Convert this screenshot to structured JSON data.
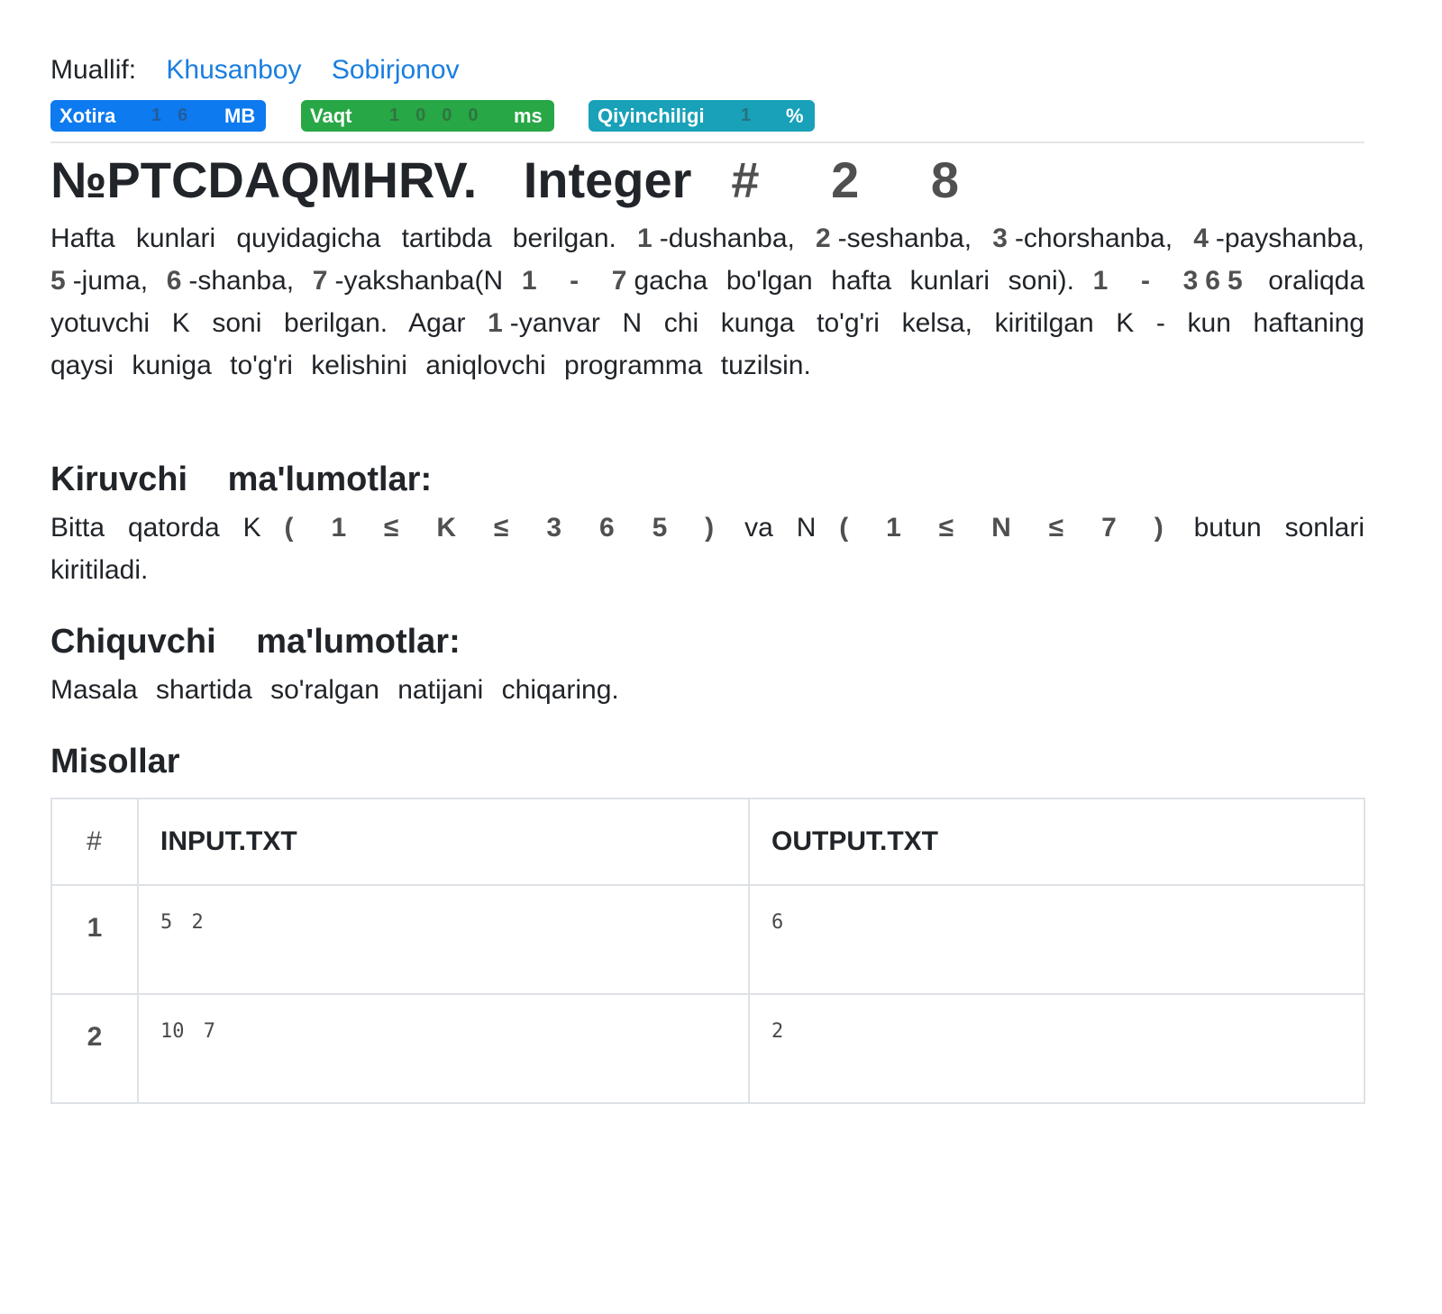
{
  "author": {
    "label": "Muallif:",
    "first_name": "Khusanboy",
    "last_name": "Sobirjonov"
  },
  "badges": {
    "memory": {
      "label": "Xotira",
      "value": "16",
      "unit": "MB"
    },
    "time": {
      "label": "Vaqt",
      "value": "1000",
      "unit": "ms"
    },
    "difficulty": {
      "label": "Qiyinchiligi",
      "value": "1",
      "unit": "%"
    }
  },
  "problem": {
    "code": "№PTCDAQMHRV.",
    "name": "Integer",
    "hash": "# 2 8"
  },
  "statement": {
    "s1": "Hafta kunlari quyidagicha tartibda berilgan.",
    "n1": "1",
    "d1": "-dushanba,",
    "n2": "2",
    "d2": "-seshanba,",
    "n3": "3",
    "d3": "-chorshanba,",
    "n4": "4",
    "d4": "-payshanba,",
    "n5": "5",
    "d5": "-juma,",
    "n6": "6",
    "d6": "-shanba,",
    "n7": "7",
    "d7": "-yakshanba(N",
    "range1": "1 - 7",
    "s2": "gacha bo'lgan hafta kunlari soni).",
    "range2": "1 - 365",
    "s3": "oraliqda yotuvchi K soni berilgan. Agar",
    "n8": "1",
    "s4": "-yanvar N chi kunga to'g'ri kelsa, kiritilgan K - kun haftaning qaysi kuniga to'g'ri kelishini aniqlovchi programma tuzilsin."
  },
  "input_section": {
    "heading": "Kiruvchi ma'lumotlar:",
    "t1": "Bitta qatorda K",
    "t2": "( 1 ≤ K ≤ 3 6 5 )",
    "t3": "va N",
    "t4": "( 1 ≤ N ≤ 7 )",
    "t5": "butun sonlari kiritiladi."
  },
  "output_section": {
    "heading": "Chiquvchi ma'lumotlar:",
    "text": "Masala shartida so'ralgan natijani chiqaring."
  },
  "examples": {
    "heading": "Misollar",
    "columns": [
      "#",
      "INPUT.TXT",
      "OUTPUT.TXT"
    ],
    "rows": [
      {
        "num": "1",
        "input": "5 2",
        "output": "6"
      },
      {
        "num": "2",
        "input": "10 7",
        "output": "2"
      }
    ]
  }
}
